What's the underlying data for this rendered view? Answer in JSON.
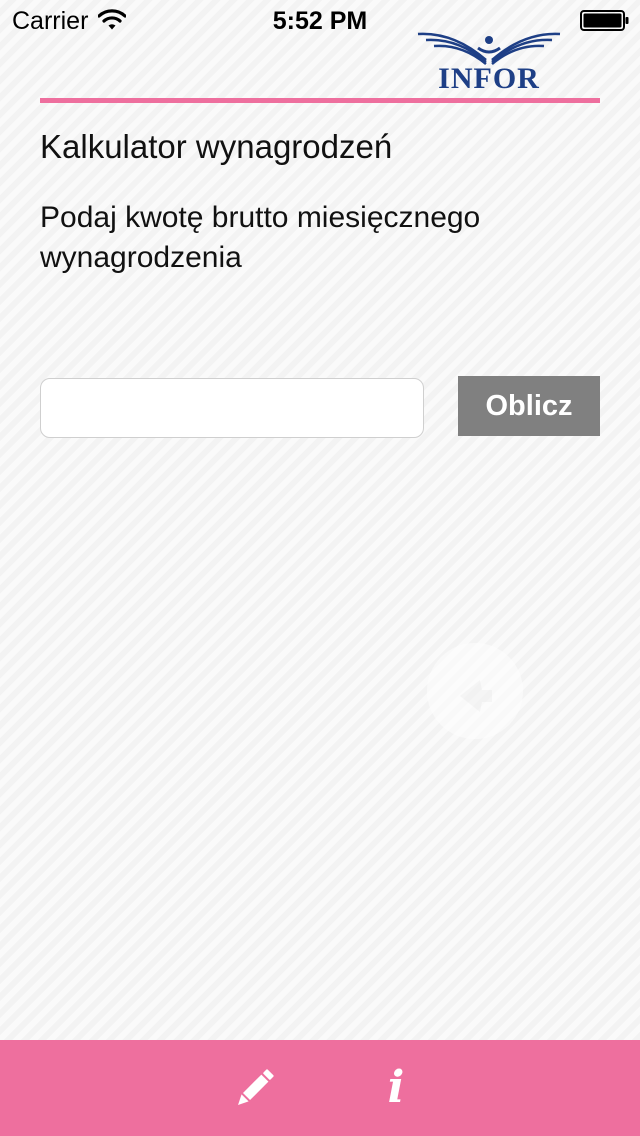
{
  "status_bar": {
    "carrier": "Carrier",
    "time": "5:52 PM",
    "wifi_icon": "wifi-icon",
    "battery_icon": "battery-full-icon"
  },
  "header": {
    "logo_text": "INFOR",
    "logo_color": "#1e3f86",
    "accent_color": "#ee6f9e"
  },
  "main": {
    "title": "Kalkulator wynagrodzeń",
    "prompt": "Podaj kwotę brutto miesięcznego wynagrodzenia",
    "amount_input": {
      "value": "",
      "placeholder": ""
    },
    "calculate_button": "Oblicz"
  },
  "tab_bar": {
    "background_color": "#ee6f9e",
    "items": [
      {
        "icon": "pencil-icon"
      },
      {
        "icon": "info-icon",
        "glyph": "i"
      }
    ]
  }
}
